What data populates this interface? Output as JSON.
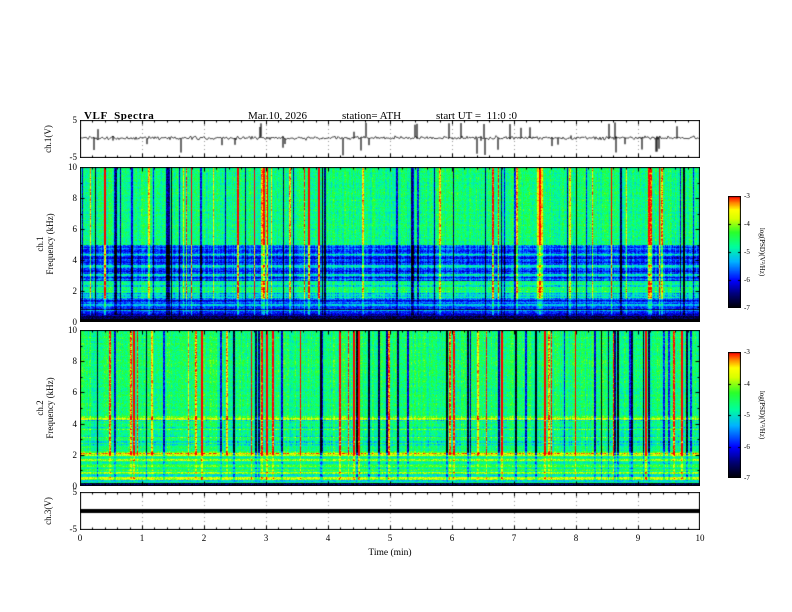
{
  "header": {
    "title": "VLF  Spectra",
    "date": "Mar.10, 2026",
    "station": "station= ATH",
    "start_ut": "start UT =  11:0 :0"
  },
  "xaxis": {
    "label": "Time (min)",
    "ticks": [
      "0",
      "1",
      "2",
      "3",
      "4",
      "5",
      "6",
      "7",
      "8",
      "9",
      "10"
    ]
  },
  "ylabels": {
    "ch1v": "ch.1(V)",
    "ch1": "ch.1",
    "ch2": "ch.2",
    "freq": "Frequency (kHz)",
    "ch3v": "ch.3(V)"
  },
  "yticks": {
    "volts": [
      "5",
      "-5"
    ],
    "freq": [
      "10",
      "8",
      "6",
      "4",
      "2",
      "0"
    ]
  },
  "colorbar": {
    "label": "log(PSD)(V²/Hz)",
    "ticks": [
      "-3",
      "-4",
      "-5",
      "-6",
      "-7"
    ]
  },
  "colormap": [
    [
      0.0,
      "#000000"
    ],
    [
      0.12,
      "#00006e"
    ],
    [
      0.25,
      "#0000ff"
    ],
    [
      0.42,
      "#00b4ff"
    ],
    [
      0.55,
      "#00ff9c"
    ],
    [
      0.68,
      "#2aff2a"
    ],
    [
      0.8,
      "#d8ff00"
    ],
    [
      0.88,
      "#ffff00"
    ],
    [
      0.94,
      "#ff8c00"
    ],
    [
      1.0,
      "#ff0000"
    ]
  ],
  "chart_data": {
    "type": "heatmap",
    "title": "VLF Spectra",
    "date": "Mar.10, 2026",
    "station": "ATH",
    "start_ut": "11:0:0",
    "x_axis": {
      "label": "Time (min)",
      "range": [
        0,
        10
      ]
    },
    "z_axis": {
      "label": "log(PSD)(V²/Hz)",
      "range": [
        -7,
        -3
      ]
    },
    "panels": [
      {
        "id": "ch1_waveform",
        "kind": "line",
        "ylabel": "ch.1(V)",
        "y_range": [
          -5,
          5
        ],
        "summary": "broadband noise near 0 V with dense impulsive spikes reaching ±5 V",
        "synth": {
          "seed": 7,
          "spike_prob": 0.07,
          "noise_v": 0.6,
          "spike_v": [
            1.5,
            5
          ]
        }
      },
      {
        "id": "ch1_spectrogram",
        "kind": "heatmap",
        "ylabel": "ch.1 Frequency (kHz)",
        "y_range": [
          0,
          10
        ],
        "z_range": [
          -7,
          -3
        ],
        "summary": "green band above 5 kHz (~-4.6), blue 2.7-5 kHz (~-5.8), green band near 2 kHz, navy 0.5-1.6 kHz, black below 0.45 kHz; dense vertical red surge streaks and dark dropout streaks",
        "synth": {
          "seed": 11,
          "bands": [
            [
              0,
              0.45,
              -7
            ],
            [
              0.45,
              0.9,
              -6.4
            ],
            [
              0.9,
              1.6,
              -5.8
            ],
            [
              1.6,
              2.7,
              -5.0
            ],
            [
              2.7,
              5.0,
              -5.8
            ],
            [
              5.0,
              10,
              -4.65
            ]
          ],
          "lines": [
            [
              0.7,
              -5.5,
              0.08
            ],
            [
              1.1,
              -5.3,
              0.08
            ],
            [
              2.1,
              -4.6,
              0.18
            ],
            [
              2.5,
              -4.8,
              0.12
            ],
            [
              3.05,
              -5.2,
              0.1
            ],
            [
              3.6,
              -5.3,
              0.08
            ],
            [
              4.4,
              -5.2,
              0.08
            ]
          ],
          "row_sigma": [
            [
              0,
              5,
              0.4
            ],
            [
              5,
              10,
              0.12
            ]
          ],
          "stripe_mask": [
            [
              0,
              0.5,
              0.05
            ],
            [
              0.5,
              1.5,
              0.4
            ],
            [
              1.5,
              10,
              1
            ]
          ],
          "pix_noise": 0.3,
          "red_prob": 0.055,
          "dark_prob": 0.055
        }
      },
      {
        "id": "ch2_spectrogram",
        "kind": "heatmap",
        "ylabel": "ch.2 Frequency (kHz)",
        "y_range": [
          0,
          10
        ],
        "z_range": [
          -7,
          -3
        ],
        "summary": "green field (~-4.6) with vertical surge/dropout streaks above 4 kHz; many horizontal yellow-orange lines below 4.5 kHz (0.5, 0.85, 1.3, 1.7, 2.05, 2.5, 3.1, 3.7, 4.35 kHz); thin dark band at the very bottom",
        "synth": {
          "seed": 23,
          "bands": [
            [
              0,
              0.25,
              -6.7
            ],
            [
              0.25,
              0.9,
              -4.9
            ],
            [
              0.9,
              2.0,
              -4.6
            ],
            [
              2.0,
              2.3,
              -4.3
            ],
            [
              2.3,
              4.3,
              -4.85
            ],
            [
              4.3,
              10,
              -4.6
            ]
          ],
          "lines": [
            [
              0.5,
              -3.8,
              0.08
            ],
            [
              0.85,
              -4.1,
              0.07
            ],
            [
              1.3,
              -4.2,
              0.07
            ],
            [
              1.7,
              -4.0,
              0.07
            ],
            [
              2.05,
              -3.6,
              0.12
            ],
            [
              2.5,
              -4.35,
              0.07
            ],
            [
              3.1,
              -4.45,
              0.07
            ],
            [
              3.7,
              -4.4,
              0.07
            ],
            [
              4.35,
              -3.9,
              0.1
            ]
          ],
          "row_sigma": [
            [
              0,
              4.5,
              0.35
            ],
            [
              4.5,
              10,
              0.12
            ]
          ],
          "stripe_mask": [
            [
              0,
              0.4,
              0.08
            ],
            [
              0.4,
              2.0,
              0.35
            ],
            [
              2.0,
              10,
              1
            ]
          ],
          "pix_noise": 0.3,
          "red_prob": 0.045,
          "dark_prob": 0.05
        }
      },
      {
        "id": "ch3_waveform",
        "kind": "line",
        "ylabel": "ch.3(V)",
        "y_range": [
          -5,
          5
        ],
        "summary": "constant 0 V flat thick trace (channel inactive)",
        "value_v": 0
      }
    ]
  }
}
